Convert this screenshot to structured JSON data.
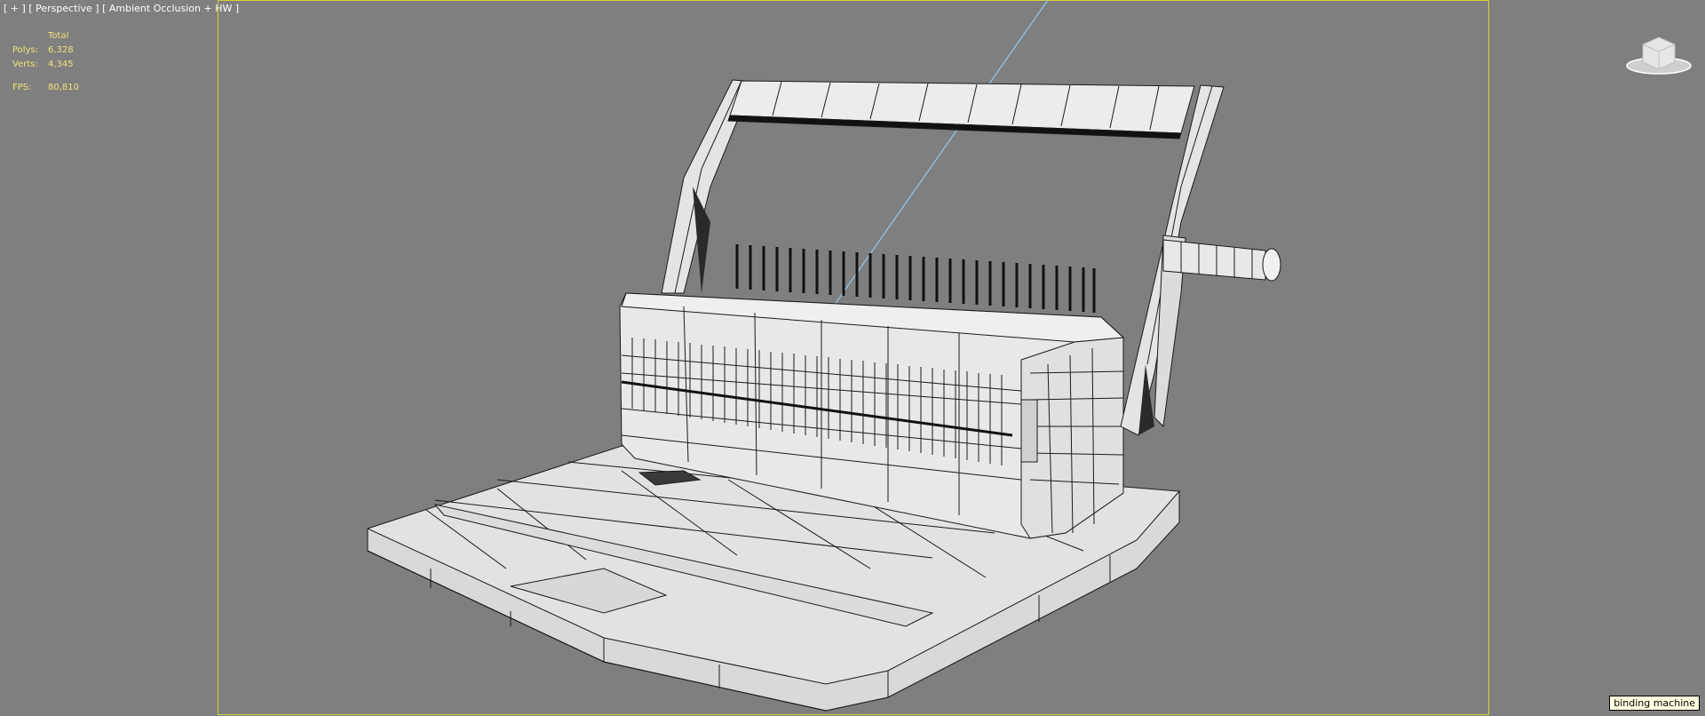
{
  "viewport": {
    "label_plus": "[ + ]",
    "label_view": "[ Perspective ]",
    "label_shading": "[ Ambient Occlusion + HW ]"
  },
  "stats": {
    "header": "Total",
    "polys_label": "Polys:",
    "polys_value": "6,328",
    "verts_label": "Verts:",
    "verts_value": "4,345",
    "fps_label": "FPS:",
    "fps_value": "80,810"
  },
  "tooltip": {
    "text": "binding machine"
  },
  "colors": {
    "viewport_bg": "#7f7f7f",
    "safe_frame": "#d4d23a",
    "stats_text": "#f0e37a",
    "mesh_fill": "#e6e6e6",
    "wire": "#1a1a1a",
    "guide_line": "#8fc8f0"
  },
  "icons": {
    "viewcube": "viewcube-icon"
  }
}
